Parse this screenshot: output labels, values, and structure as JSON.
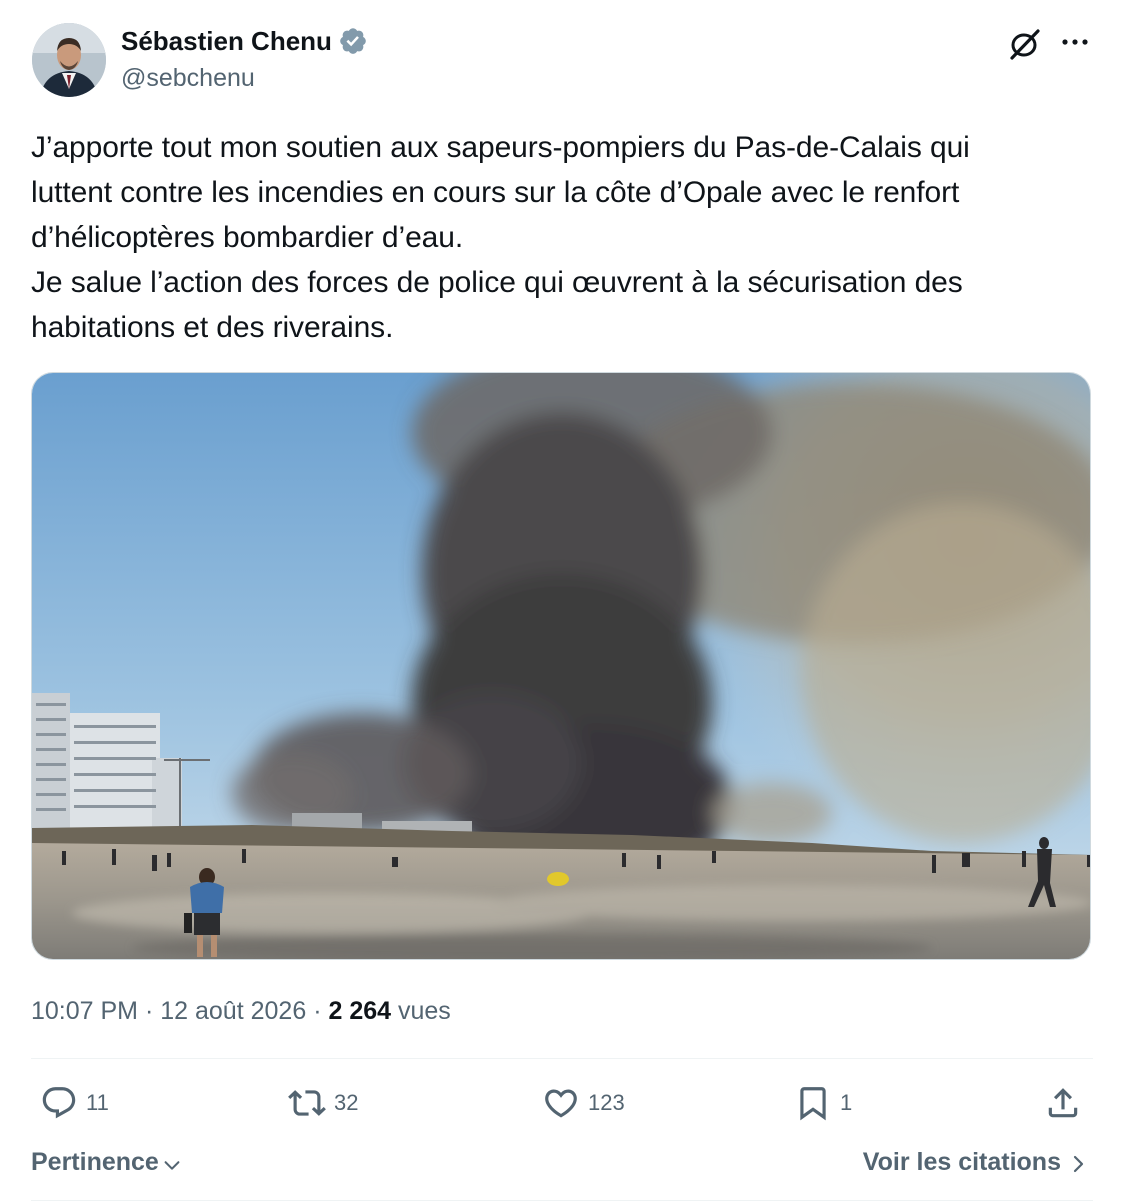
{
  "author": {
    "name": "Sébastien Chenu",
    "handle": "@sebchenu",
    "verified": true,
    "verified_color": "#829aab"
  },
  "header_icons": [
    "grok-icon",
    "more-icon"
  ],
  "tweet": {
    "text": "J’apporte tout mon soutien aux sapeurs-pompiers du Pas-de-Calais qui\nluttent contre les incendies en cours sur la côte d’Opale avec le renfort\nd’hélicoptères bombardier d’eau.\nJe salue l’action des forces de police qui œuvrent à la sécurisation des\nhabitations et des riverains.",
    "media_icon": "beach-fire-smoke-photo"
  },
  "meta": {
    "time": "10:07 PM",
    "separator": "·",
    "date": "12 août 2026",
    "views_count": "2 264",
    "views_label": "vues"
  },
  "actions": {
    "replies": "11",
    "reposts": "32",
    "likes": "123",
    "bookmarks": "1"
  },
  "footer": {
    "sort_label": "Pertinence",
    "quotes_label": "Voir les citations"
  },
  "colors": {
    "text": "#0f1419",
    "secondary": "#536471",
    "divider": "#eff3f4"
  }
}
